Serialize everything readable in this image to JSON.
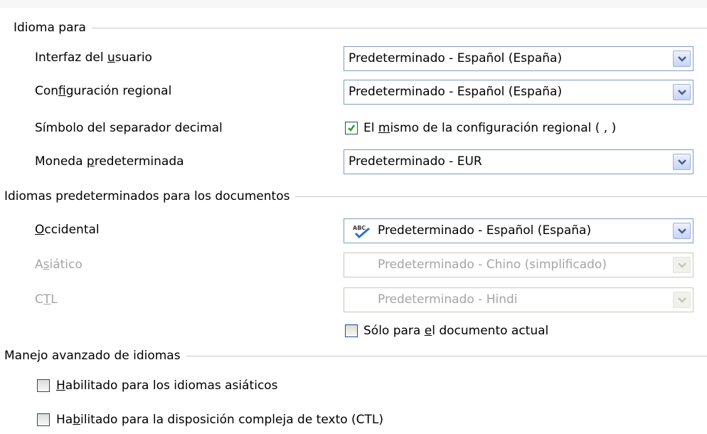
{
  "sections": {
    "idioma_para": "Idioma para",
    "idiomas_predeterminados": "Idiomas predeterminados para los documentos",
    "manejo_avanzado": "Manejo avanzado de idiomas"
  },
  "ui_language": {
    "label_pre": "Interfaz del ",
    "label_u": "u",
    "label_post": "suario",
    "value": "Predeterminado - Español (España)"
  },
  "locale": {
    "label_pre": "Con",
    "label_u": "f",
    "label_post": "iguración regional",
    "value": "Predeterminado - Español (España)"
  },
  "decimal": {
    "label": "Símbolo del separador decimal",
    "check_pre": "El ",
    "check_u": "m",
    "check_post": "ismo de la configuración regional ( , )",
    "checked": true
  },
  "currency": {
    "label_pre": "Moneda ",
    "label_u": "p",
    "label_post": "redeterminada",
    "value": "Predeterminado - EUR"
  },
  "western": {
    "label_u": "O",
    "label_post": "ccidental",
    "value": "Predeterminado - Español (España)",
    "icon": "spellcheck-icon"
  },
  "asian": {
    "label_pre": "A",
    "label_u": "s",
    "label_post": "iático",
    "value": "Predeterminado - Chino (simplificado)",
    "enabled": false
  },
  "ctl": {
    "label_pre": "C",
    "label_u": "T",
    "label_post": "L",
    "value": "Predeterminado - Hindi",
    "enabled": false
  },
  "current_doc": {
    "label_pre": "Sólo para ",
    "label_u": "e",
    "label_post": "l documento actual",
    "checked": false
  },
  "asian_enabled": {
    "label_u": "H",
    "label_post": "abilitado para los idiomas asiáticos",
    "checked": false
  },
  "ctl_enabled": {
    "label_pre": "Ha",
    "label_u": "b",
    "label_post": "ilitado para la disposición compleja de texto (CTL)",
    "checked": false
  },
  "colors": {
    "combo_border": "#7f9db9",
    "disabled_text": "#a5a5a5",
    "check_green": "#21a121"
  }
}
